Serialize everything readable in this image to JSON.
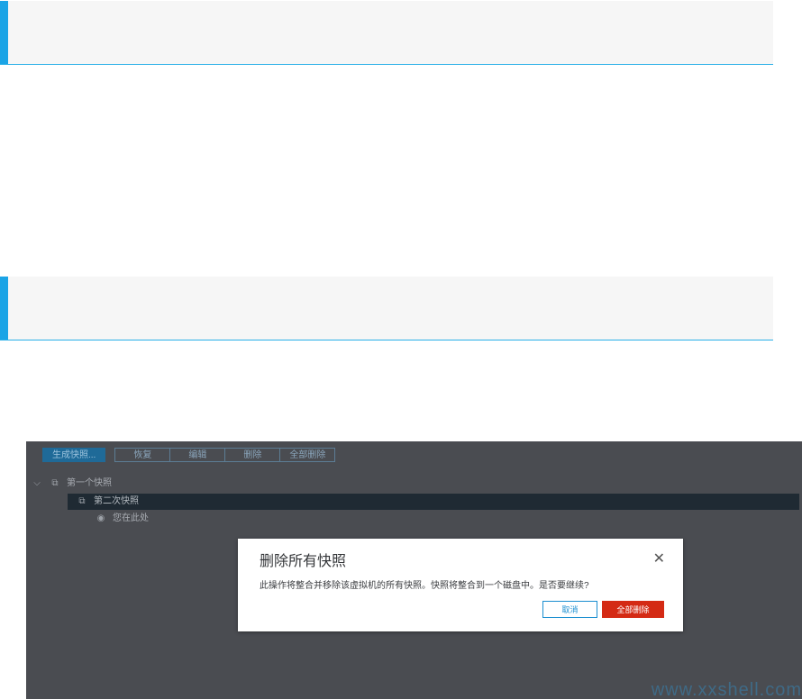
{
  "sections": [
    {
      "heading": ""
    },
    {
      "heading": ""
    }
  ],
  "screenshot": {
    "toolbar": {
      "create_snapshot": "生成快照...",
      "restore": "恢复",
      "edit": "编辑",
      "delete": "删除",
      "delete_all": "全部删除"
    },
    "tree": {
      "snapshot_1": "第一个快照",
      "snapshot_2": "第二次快照",
      "you_are_here": "您在此处"
    },
    "dialog": {
      "title": "删除所有快照",
      "message": "此操作将整合并移除该虚拟机的所有快照。快照将整合到一个磁盘中。是否要继续?",
      "cancel_label": "取消",
      "confirm_label": "全部删除",
      "close_icon": "close-icon"
    },
    "watermark": "www.xxshell.com"
  },
  "colors": {
    "accent": "#1ba4e6",
    "danger": "#d42a14",
    "primary": "#1b8ed0"
  }
}
